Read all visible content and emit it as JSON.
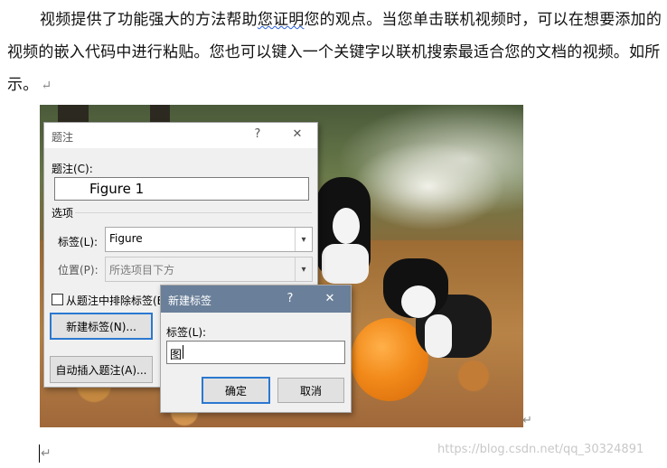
{
  "document": {
    "line1": "视频提供了功能强大的方法帮助",
    "underlined": "您证明",
    "line1_rest": "您的观点。当您单击联机视频时，可以在想要添加的视频的嵌入代码中进行粘贴。您也可以键入一个关键字以联机搜索最适合您的文档的视频。如所示。",
    "return_mark": "↵",
    "watermark": "https://blog.csdn.net/qq_30324891"
  },
  "caption_dialog": {
    "title": "题注",
    "help": "?",
    "close": "✕",
    "caption_label": "题注(C):",
    "caption_value": "Figure 1",
    "options_label": "选项",
    "label_label": "标签(L):",
    "label_value": "Figure",
    "position_label": "位置(P):",
    "position_value": "所选项目下方",
    "exclude_label": "从题注中排除标签(E",
    "new_label_button": "新建标签(N)...",
    "autocaption_button": "自动插入题注(A)..."
  },
  "new_label_dialog": {
    "title": "新建标签",
    "help": "?",
    "close": "✕",
    "label_label": "标签(L):",
    "label_value": "图",
    "ok": "确定",
    "cancel": "取消"
  },
  "icons": {
    "dropdown": "chevron-down-icon",
    "close": "close-icon",
    "help": "help-icon"
  }
}
